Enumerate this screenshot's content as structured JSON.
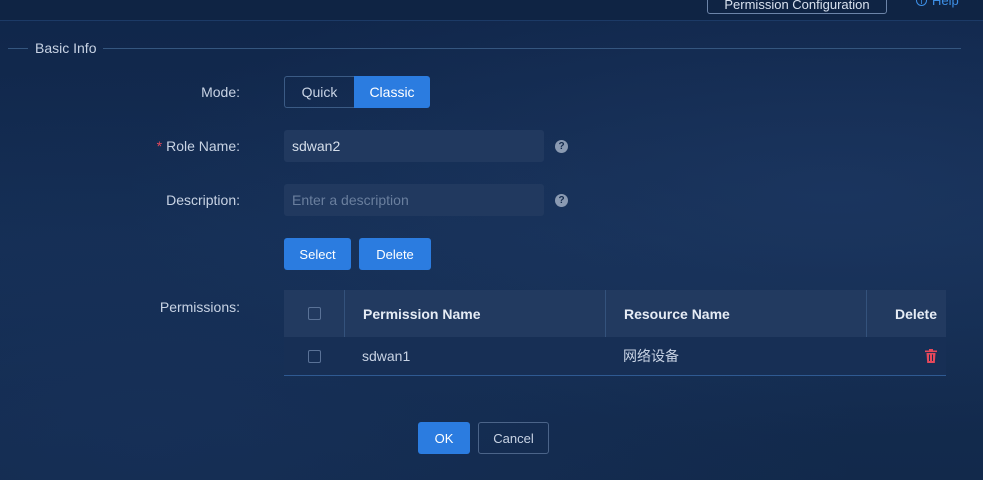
{
  "top": {
    "permission_config_label": "Permission Configuration",
    "help_label": "Help"
  },
  "section": {
    "title": "Basic Info"
  },
  "form": {
    "mode": {
      "label": "Mode:",
      "options": [
        "Quick",
        "Classic"
      ],
      "selected": "Classic"
    },
    "role_name": {
      "required_mark": "*",
      "label": "Role Name:",
      "value": "sdwan2"
    },
    "description": {
      "label": "Description:",
      "value": "",
      "placeholder": "Enter a description"
    },
    "permissions_label": "Permissions:"
  },
  "actions": {
    "select_label": "Select",
    "delete_label": "Delete"
  },
  "table": {
    "columns": [
      "Permission Name",
      "Resource Name",
      "Delete"
    ],
    "rows": [
      {
        "permission_name": "sdwan1",
        "resource_name": "网络设备"
      }
    ]
  },
  "footer": {
    "ok_label": "OK",
    "cancel_label": "Cancel"
  },
  "colors": {
    "accent": "#2b7ce0",
    "danger": "#e5485b",
    "background": "#132a4c"
  },
  "icons": {
    "help": "info-circle-icon",
    "tooltip": "question-circle-icon",
    "delete_row": "trash-icon"
  }
}
